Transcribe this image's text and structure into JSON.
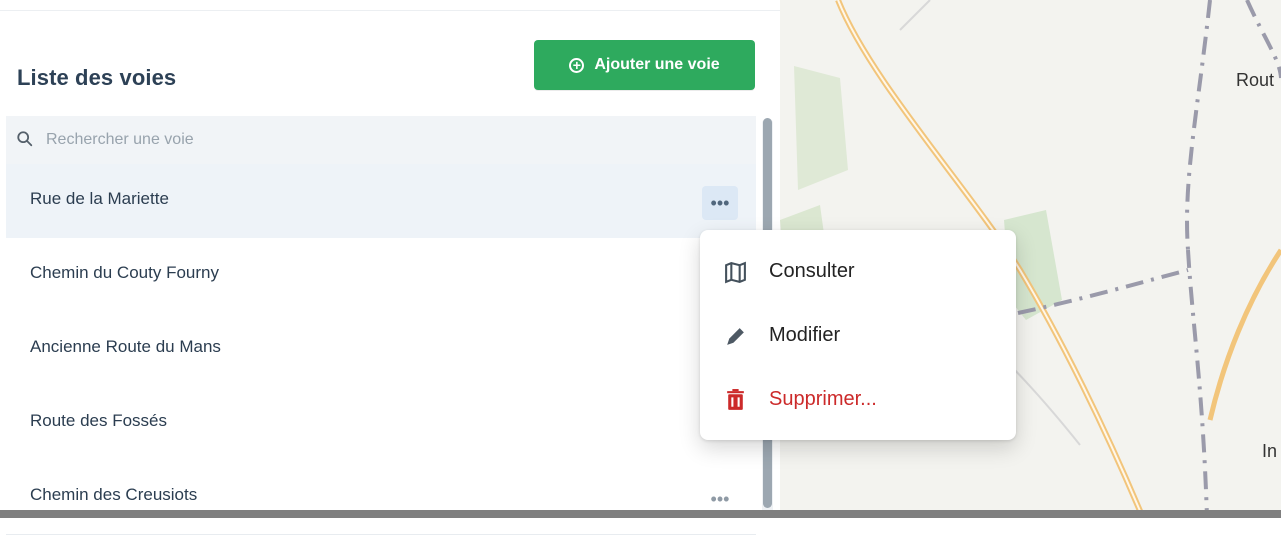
{
  "header": {
    "title": "Liste des voies",
    "add_button_label": "Ajouter une voie"
  },
  "search": {
    "placeholder": "Rechercher une voie"
  },
  "list": {
    "items": [
      {
        "label": "Rue de la Mariette",
        "active": true
      },
      {
        "label": "Chemin du Couty Fourny"
      },
      {
        "label": "Ancienne Route du Mans"
      },
      {
        "label": "Route des Fossés"
      },
      {
        "label": "Chemin des Creusiots"
      }
    ],
    "more_label": "•••"
  },
  "menu": {
    "items": [
      {
        "label": "Consulter",
        "icon": "map-icon"
      },
      {
        "label": "Modifier",
        "icon": "pencil-icon"
      },
      {
        "label": "Supprimer...",
        "icon": "trash-icon"
      }
    ]
  },
  "map": {
    "labels": [
      "Rout",
      "In"
    ]
  },
  "colors": {
    "accent": "#2eaa5e",
    "danger": "#cc2a2a"
  }
}
